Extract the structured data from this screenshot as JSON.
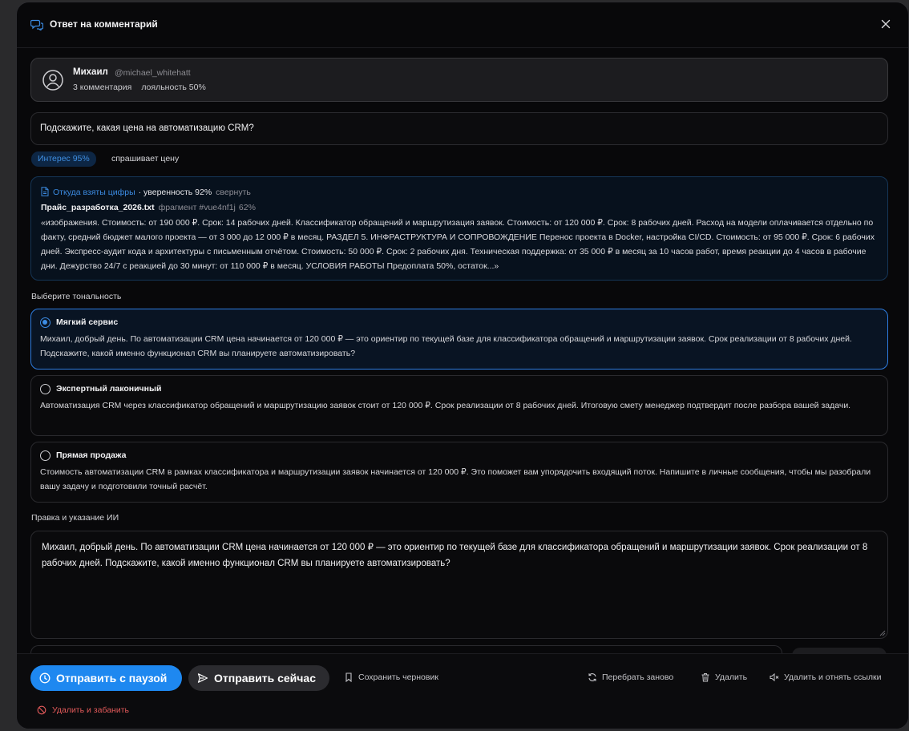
{
  "dialog": {
    "title": "Ответ на комментарий",
    "accent": "#1e88f0"
  },
  "user": {
    "name": "Михаил",
    "handle": "@michael_whitehatt",
    "comments": "3 комментария",
    "loyalty": "лояльность 50%"
  },
  "question": {
    "text": "Подскажите, какая цена на автоматизацию CRM?"
  },
  "intent": {
    "interest_badge": "Интерес 95%",
    "intent_label": "спрашивает цену"
  },
  "source": {
    "link_label": "Откуда взяты цифры",
    "confidence": "· уверенность 92%",
    "collapse_label": "свернуть",
    "file_name": "Прайс_разработка_2026.txt",
    "fragment": "фрагмент #vue4nf1j",
    "fragment_score": "62%",
    "quote": "«изображения. Стоимость: от 190 000 ₽. Срок: 14 рабочих дней. Классификатор обращений и маршрутизация заявок. Стоимость: от 120 000 ₽. Срок: 8 рабочих дней. Расход на модели оплачивается отдельно по факту, средний бюджет малого проекта — от 3 000 до 12 000 ₽ в месяц. РАЗДЕЛ 5. ИНФРАСТРУКТУРА И СОПРОВОЖДЕНИЕ Перенос проекта в Docker, настройка CI/CD. Стоимость: от 95 000 ₽. Срок: 6 рабочих дней. Экспресс-аудит кода и архитектуры с письменным отчётом. Стоимость: 50 000 ₽. Срок: 2 рабочих дня. Техническая поддержка: от 35 000 ₽ в месяц за 10 часов работ, время реакции до 4 часов в рабочие дни. Дежурство 24/7 с реакцией до 30 минут: от 110 000 ₽ в месяц. УСЛОВИЯ РАБОТЫ Предоплата 50%, остаток...»"
  },
  "tone": {
    "section_label": "Выберите тональность",
    "options": [
      {
        "title": "Мягкий сервис",
        "selected": true,
        "text": "Михаил, добрый день. По автоматизации CRM цена начинается от 120 000 ₽ — это ориентир по текущей базе для классификатора обращений и маршрутизации заявок. Срок реализации от 8 рабочих дней. Подскажите, какой именно функционал CRM вы планируете автоматизировать?"
      },
      {
        "title": "Экспертный лаконичный",
        "selected": false,
        "text": "Автоматизация CRM через классификатор обращений и маршрутизацию заявок стоит от 120 000 ₽. Срок реализации от 8 рабочих дней. Итоговую смету менеджер подтвердит после разбора вашей задачи."
      },
      {
        "title": "Прямая продажа",
        "selected": false,
        "text": "Стоимость автоматизации CRM в рамках классификатора и маршрутизации заявок начинается от 120 000 ₽. Это поможет вам упорядочить входящий поток. Напишите в личные сообщения, чтобы мы разобрали вашу задачу и подготовили точный расчёт."
      }
    ]
  },
  "editor": {
    "section_label": "Правка и указание ИИ",
    "value": "Михаил, добрый день. По автоматизации CRM цена начинается от 120 000 ₽ — это ориентир по текущей базе для классификатора обращений и маршрутизации заявок. Срок реализации от 8 рабочих дней. Подскажите, какой именно функционал CRM вы планируете автоматизировать?"
  },
  "actions": {
    "send_with_pause": "Отправить с паузой",
    "send_now": "Отправить сейчас",
    "save_draft": "Сохранить черновик",
    "regenerate": "Перебрать заново",
    "delete": "Удалить",
    "delete_and_remove_links": "Удалить и отнять ссылки",
    "delete_and_ban": "Удалить и забанить"
  }
}
